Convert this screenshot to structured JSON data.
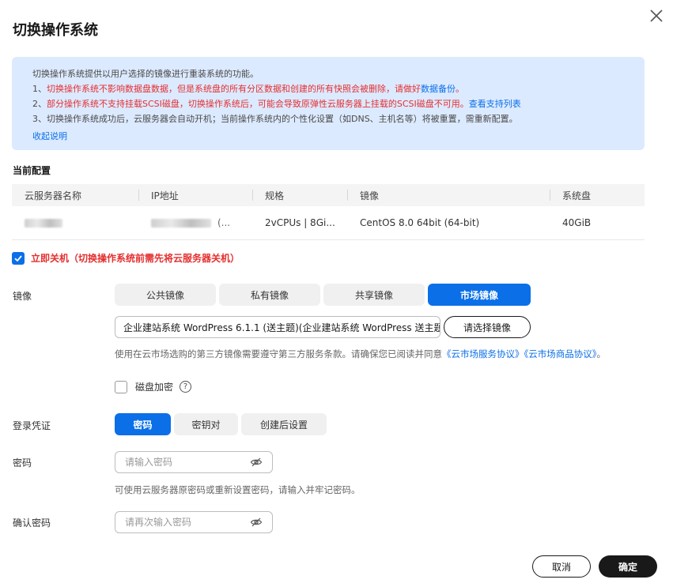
{
  "dialog": {
    "title": "切换操作系统",
    "close_icon": "close-icon"
  },
  "notice": {
    "line0": "切换操作系统提供以用户选择的镜像进行重装系统的功能。",
    "line1_prefix": "1、",
    "line1_red": "切换操作系统不影响数据盘数据，但是系统盘的所有分区数据和创建的所有快照会被删除，请做好",
    "line1_link": "数据备份",
    "line1_suffix": "。",
    "line2_prefix": "2、",
    "line2_red": "部分操作系统不支持挂载SCSI磁盘，切换操作系统后，可能会导致原弹性云服务器上挂载的SCSI磁盘不可用。",
    "line2_link": "查看支持列表",
    "line3": "3、切换操作系统成功后，云服务器会自动开机；当前操作系统内的个性化设置（如DNS、主机名等）将被重置，需重新配置。",
    "collapse": "收起说明"
  },
  "current_config": {
    "title": "当前配置",
    "columns": [
      "云服务器名称",
      "IP地址",
      "规格",
      "镜像",
      "系统盘"
    ],
    "row": {
      "name": "",
      "ip_suffix": "(...",
      "spec": "2vCPUs | 8Gi...",
      "image": "CentOS 8.0 64bit (64-bit)",
      "disk": "40GiB"
    }
  },
  "shutdown": {
    "checked": true,
    "label": "立即关机（切换操作系统前需先将云服务器关机）"
  },
  "image": {
    "label": "镜像",
    "tabs": [
      "公共镜像",
      "私有镜像",
      "共享镜像",
      "市场镜像"
    ],
    "active_tab": "市场镜像",
    "selected_value": "企业建站系统 WordPress 6.1.1 (送主题)(企业建站系统 WordPress 送主题",
    "select_button": "请选择镜像",
    "terms_prefix": "使用在云市场选购的第三方镜像需要遵守第三方服务条款。请确保您已阅读并同意",
    "terms_link1": "《云市场服务协议》",
    "terms_link2": "《云市场商品协议》",
    "terms_suffix": "。"
  },
  "encryption": {
    "checked": false,
    "label": "磁盘加密",
    "help": "?"
  },
  "credential": {
    "label": "登录凭证",
    "options": [
      "密码",
      "密钥对",
      "创建后设置"
    ],
    "active": "密码"
  },
  "password": {
    "label": "密码",
    "placeholder": "请输入密码",
    "hint": "可使用云服务器原密码或重新设置密码，请输入并牢记密码。"
  },
  "confirm_password": {
    "label": "确认密码",
    "placeholder": "请再次输入密码"
  },
  "footer": {
    "cancel": "取消",
    "ok": "确定"
  },
  "colors": {
    "accent": "#0b6fe8",
    "warning": "#e42f2f",
    "notice_bg": "#dceaff",
    "primary_dark": "#191919"
  }
}
